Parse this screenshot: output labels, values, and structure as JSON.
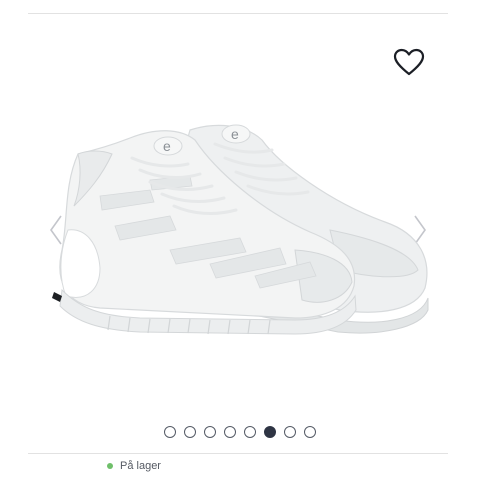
{
  "product": {
    "gallery": {
      "image_count": 8,
      "active_index": 5,
      "image_alt": "",
      "prev_icon": "chevron-left-icon",
      "next_icon": "chevron-right-icon"
    },
    "wishlist_icon": "heart-outline-icon",
    "stock": {
      "label": "På lager",
      "color": "#6fbf6a"
    }
  },
  "colors": {
    "active_dot": "#2f3544",
    "divider": "#e2e2e2"
  }
}
